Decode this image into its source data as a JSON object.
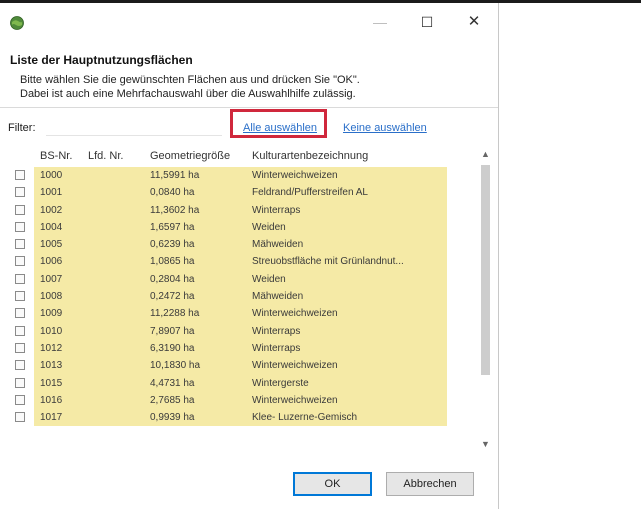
{
  "window": {
    "minimize_icon": "minimize-icon",
    "maximize_icon": "maximize-icon",
    "close_icon": "close-icon",
    "app_icon": "globe-app-icon"
  },
  "dialog": {
    "title": "Liste der Hauptnutzungsflächen",
    "message_line1": "Bitte wählen Sie die gewünschten Flächen aus und drücken Sie \"OK\".",
    "message_line2": "Dabei ist auch eine Mehrfachauswahl über die Auswahlhilfe zulässig."
  },
  "filter": {
    "label": "Filter:",
    "value": "",
    "select_all": "Alle auswählen",
    "select_none": "Keine auswählen"
  },
  "table": {
    "columns": [
      "BS-Nr.",
      "Lfd. Nr.",
      "Geometriegröße",
      "Kulturartenbezeichnung"
    ],
    "rows": [
      {
        "bs": "1000",
        "lfd": "",
        "geo": "11,5991 ha",
        "kult": "Winterweichweizen",
        "checked": false
      },
      {
        "bs": "1001",
        "lfd": "",
        "geo": "0,0840 ha",
        "kult": "Feldrand/Pufferstreifen  AL",
        "checked": false
      },
      {
        "bs": "1002",
        "lfd": "",
        "geo": "11,3602 ha",
        "kult": "Winterraps",
        "checked": false
      },
      {
        "bs": "1004",
        "lfd": "",
        "geo": "1,6597 ha",
        "kult": "Weiden",
        "checked": false
      },
      {
        "bs": "1005",
        "lfd": "",
        "geo": "0,6239 ha",
        "kult": "Mähweiden",
        "checked": false
      },
      {
        "bs": "1006",
        "lfd": "",
        "geo": "1,0865 ha",
        "kult": "Streuobstfläche mit Grünlandnut...",
        "checked": false
      },
      {
        "bs": "1007",
        "lfd": "",
        "geo": "0,2804 ha",
        "kult": "Weiden",
        "checked": false
      },
      {
        "bs": "1008",
        "lfd": "",
        "geo": "0,2472 ha",
        "kult": "Mähweiden",
        "checked": false
      },
      {
        "bs": "1009",
        "lfd": "",
        "geo": "11,2288 ha",
        "kult": "Winterweichweizen",
        "checked": false
      },
      {
        "bs": "1010",
        "lfd": "",
        "geo": "7,8907 ha",
        "kult": "Winterraps",
        "checked": false
      },
      {
        "bs": "1012",
        "lfd": "",
        "geo": "6,3190 ha",
        "kult": "Winterraps",
        "checked": false
      },
      {
        "bs": "1013",
        "lfd": "",
        "geo": "10,1830 ha",
        "kult": "Winterweichweizen",
        "checked": false
      },
      {
        "bs": "1015",
        "lfd": "",
        "geo": "4,4731 ha",
        "kult": "Wintergerste",
        "checked": false
      },
      {
        "bs": "1016",
        "lfd": "",
        "geo": "2,7685 ha",
        "kult": "Winterweichweizen",
        "checked": false
      },
      {
        "bs": "1017",
        "lfd": "",
        "geo": "0,9939 ha",
        "kult": "Klee- Luzerne-Gemisch",
        "checked": false
      }
    ]
  },
  "buttons": {
    "ok": "OK",
    "cancel": "Abbrechen"
  },
  "colors": {
    "row_highlight": "#f5eaa6",
    "link": "#2a6fc9",
    "annotation_box": "#d0283c",
    "default_button_border": "#0078d7"
  }
}
